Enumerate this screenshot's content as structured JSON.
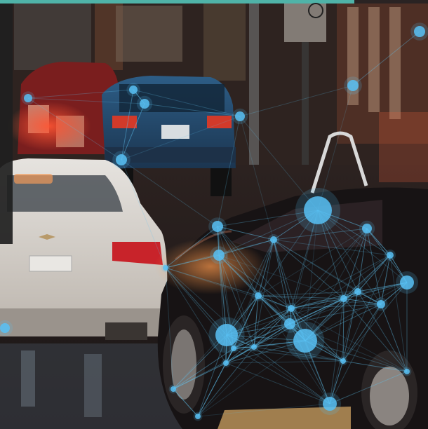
{
  "photo": {
    "subject": "city-street-traffic-night",
    "colors": {
      "accent_bar": "#4fb3a8",
      "network_line": "#5fc3f0",
      "network_node": "#58c1f5",
      "sky_tint": "#3a2a24"
    }
  },
  "network": {
    "nodes": [
      [
        598,
        45,
        8
      ],
      [
        503,
        122,
        8
      ],
      [
        342,
        166,
        7
      ],
      [
        206,
        148,
        7
      ],
      [
        190,
        128,
        6
      ],
      [
        40,
        140,
        6
      ],
      [
        173,
        228,
        8
      ],
      [
        453,
        300,
        20
      ],
      [
        310,
        323,
        8
      ],
      [
        523,
        326,
        7
      ],
      [
        390,
        342,
        5
      ],
      [
        556,
        364,
        5
      ],
      [
        580,
        403,
        10
      ],
      [
        312,
        364,
        8
      ],
      [
        368,
        422,
        5
      ],
      [
        415,
        440,
        5
      ],
      [
        510,
        416,
        5
      ],
      [
        490,
        426,
        5
      ],
      [
        543,
        434,
        6
      ],
      [
        413,
        462,
        8
      ],
      [
        435,
        486,
        17
      ],
      [
        323,
        478,
        16
      ],
      [
        362,
        495,
        4
      ],
      [
        333,
        497,
        4
      ],
      [
        7,
        468,
        7
      ],
      [
        322,
        518,
        4
      ],
      [
        470,
        576,
        10
      ],
      [
        489,
        515,
        4
      ],
      [
        580,
        530,
        4
      ],
      [
        247,
        555,
        4
      ],
      [
        282,
        594,
        4
      ],
      [
        236,
        382,
        4
      ]
    ]
  }
}
